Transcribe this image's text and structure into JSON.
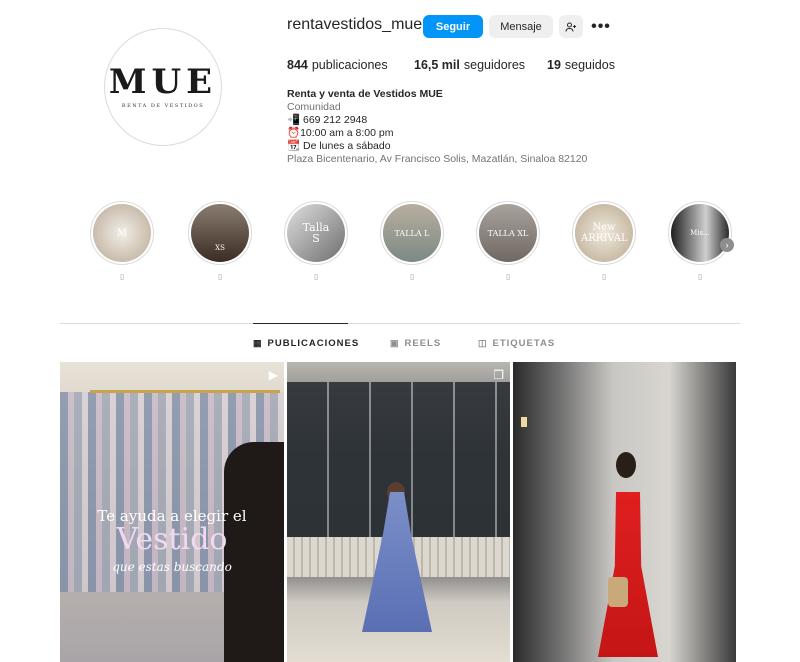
{
  "profile": {
    "username": "rentavestidos_mue",
    "avatar_text": "MUE",
    "avatar_subtext": "Renta de Vestidos",
    "follow_label": "Seguir",
    "message_label": "Mensaje",
    "more_label": "•••",
    "add_user_icon": "add-user-icon"
  },
  "stats": {
    "posts_count": "844",
    "posts_label": "publicaciones",
    "followers_count": "16,5 mil",
    "followers_label": "seguidores",
    "following_count": "19",
    "following_label": "seguidos"
  },
  "bio": {
    "name": "Renta y venta de Vestidos MUE",
    "category": "Comunidad",
    "line1": "📲 669 212 2948",
    "line2": "⏰10:00 am a 8:00 pm",
    "line3": "📆 De lunes a sábado",
    "address": "Plaza Bicentenario, Av Francisco Solis, Mazatlán, Sinaloa 82120"
  },
  "highlights": [
    {
      "text": "M",
      "label": "▯",
      "color": "#c8bba9"
    },
    {
      "text": "XS",
      "label": "▯",
      "color": "#4a3a30"
    },
    {
      "text": "Talla S",
      "label": "▯",
      "color": "#8c8c8c"
    },
    {
      "text": "TALLA L",
      "label": "▯",
      "color": "#a39b8e"
    },
    {
      "text": "TALLA XL",
      "label": "▯",
      "color": "#8f8a85"
    },
    {
      "text": "New ARRIVAL",
      "label": "▯",
      "color": "#c9bca8"
    },
    {
      "text": "Mis...",
      "label": "▯",
      "color": "#2d2d2d"
    }
  ],
  "tabs": {
    "posts": "PUBLICACIONES",
    "reels": "REELS",
    "tagged": "ETIQUETAS"
  },
  "posts": {
    "p1_caption1": "Te ayuda a elegir el",
    "p1_caption2": "Vestido",
    "p1_caption3": "que estas buscando"
  }
}
